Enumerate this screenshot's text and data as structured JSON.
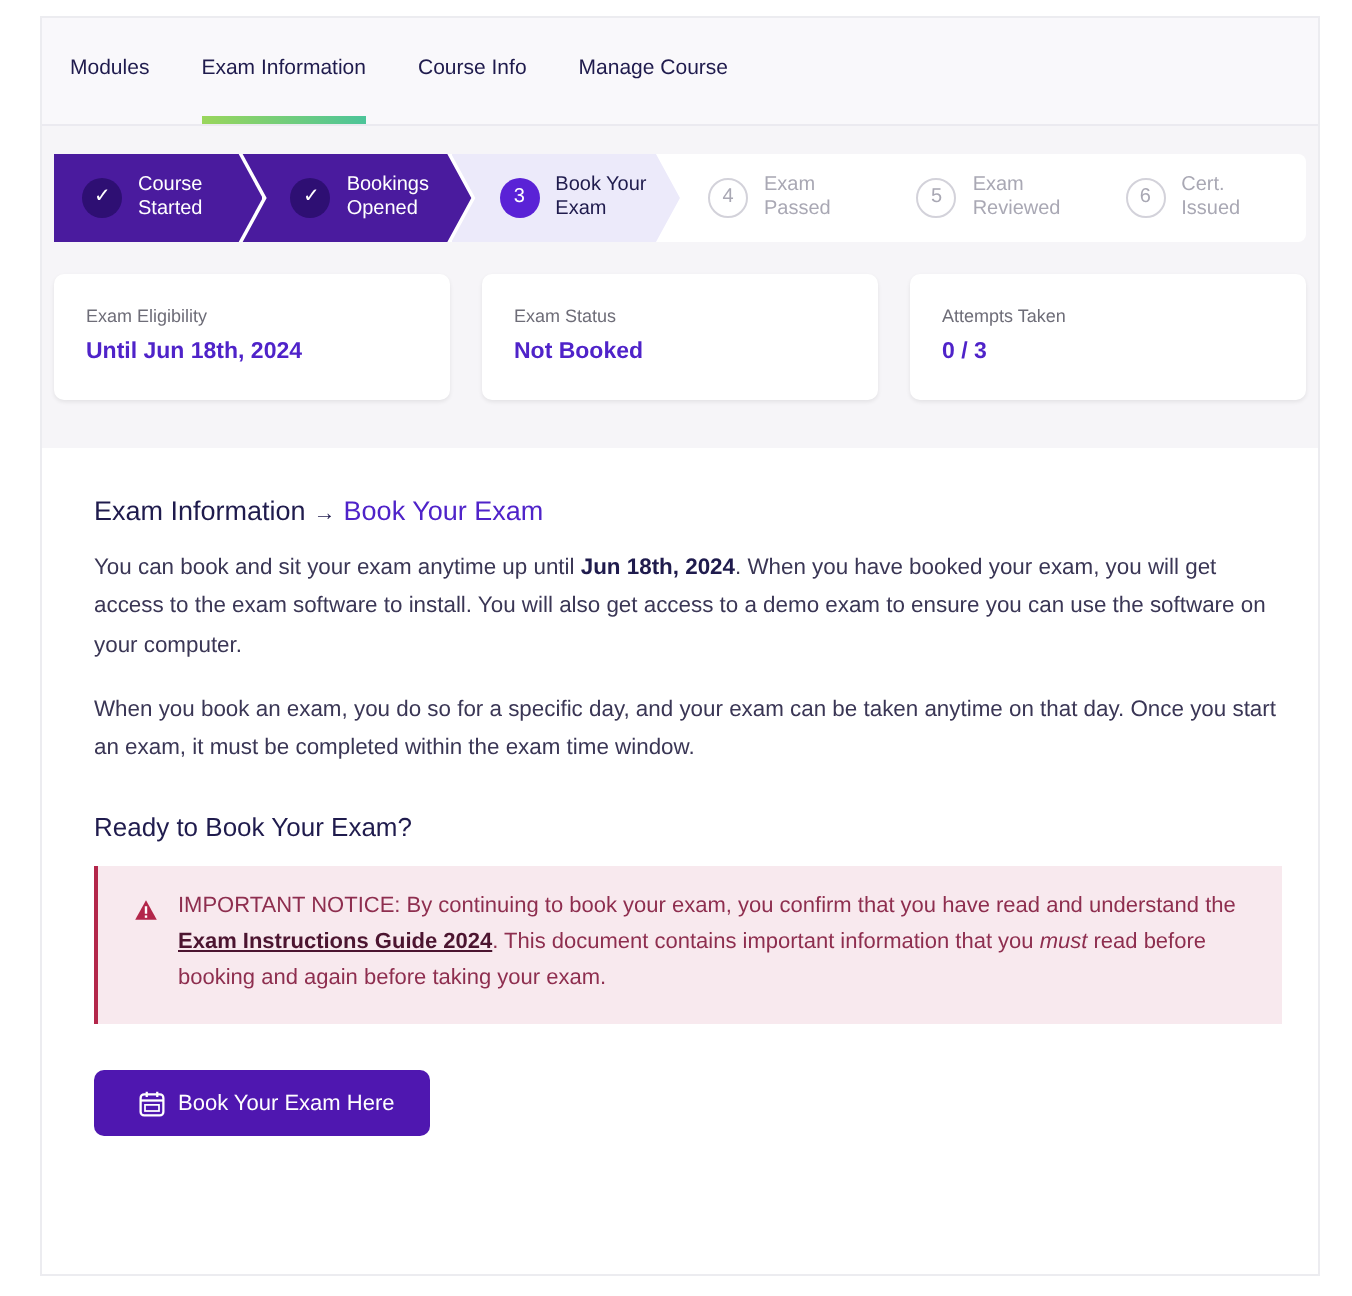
{
  "tabs": [
    {
      "label": "Modules",
      "selected": false
    },
    {
      "label": "Exam Information",
      "selected": true
    },
    {
      "label": "Course Info",
      "selected": false
    },
    {
      "label": "Manage Course",
      "selected": false
    }
  ],
  "steps": [
    {
      "marker": "✓",
      "label": "Course Started",
      "kind": "done"
    },
    {
      "marker": "✓",
      "label": "Bookings Opened",
      "kind": "done"
    },
    {
      "marker": "3",
      "label": "Book Your Exam",
      "kind": "current"
    },
    {
      "marker": "4",
      "label": "Exam Passed",
      "kind": "pending"
    },
    {
      "marker": "5",
      "label": "Exam Reviewed",
      "kind": "pending"
    },
    {
      "marker": "6",
      "label": "Cert. Issued",
      "kind": "pending"
    }
  ],
  "stats": [
    {
      "label": "Exam Eligibility",
      "value": "Until Jun 18th, 2024"
    },
    {
      "label": "Exam Status",
      "value": "Not Booked"
    },
    {
      "label": "Attempts Taken",
      "value": "0 / 3"
    }
  ],
  "section": {
    "breadcrumb_parent": "Exam Information",
    "separator": "→",
    "breadcrumb_current": "Book Your Exam",
    "paragraphs": [
      "You can book and sit your exam anytime up until **Jun 18th, 2024**. When you have booked your exam, you will get access to the exam software to install. You will also get access to a demo exam to ensure you can use the software on your computer.",
      "When you book an exam, you do so for a specific day, and your exam can be taken anytime on that day. Once you start an exam, it must be completed within the exam time window."
    ],
    "subheading": "Ready to Book Your Exam?",
    "notice": {
      "before": "IMPORTANT NOTICE: By continuing to book your exam, you confirm that you have read and understand the",
      "link": "Exam Instructions Guide 2024",
      "after": ". This document contains important information that you *must* read before booking and again before taking your exam."
    },
    "button": "Book Your Exam Here"
  }
}
